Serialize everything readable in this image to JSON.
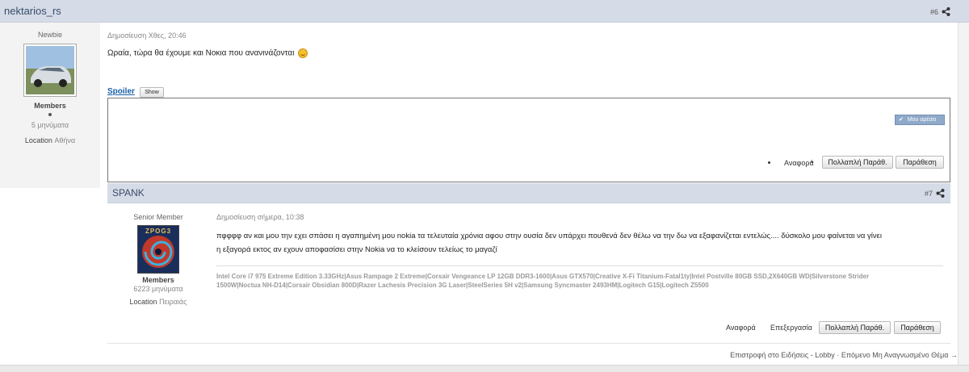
{
  "post1": {
    "author": "nektarios_rs",
    "number": "#6",
    "rank": "Newbie",
    "group": "Members",
    "posts": "5 μηνύματα",
    "location_label": "Location",
    "location": "Αθήνα",
    "date": "Δημοσίευση Χθες, 20:46",
    "text": "Ωραία, τώρα θα έχουμε και Νοκια που ανανινάζονται",
    "spoiler_label": "Spoiler",
    "spoiler_button": "Show",
    "like_button": "Μου αρέσει",
    "report": "Αναφορά",
    "multiquote": "Πολλαπλή Παράθ.",
    "quote": "Παράθεση"
  },
  "post2": {
    "author": "SPANK",
    "number": "#7",
    "rank": "Senior Member",
    "group": "Members",
    "posts": "6223 μηνύματα",
    "location_label": "Location",
    "location": "Πειραιάς",
    "date": "Δημοσίευση σήμερα, 10:38",
    "text_line1": "πφφφφ αν και μου την εχει σπάσει η αγαπημένη μου nokia τα τελευταία χρόνια αφου στην ουσία δεν υπάρχει πουθενά δεν θέλω να την δω να εξαφανίζεται εντελώς.... δύσκολο μου φαίνεται να γίνει",
    "text_line2": "η εξαγορά εκτος αν εχουν αποφασίσει στην Nokia να το κλείσουν τελείως το μαγαζί",
    "signature_line1": "Intel Core i7 975 Extreme Edition 3.33GHz|Asus Rampage 2 Extreme|Corsair Vengeance LP 12GB DDR3-1600|Asus GTX570|Creative X-Fi Titanium-Fatal1ty|Intel Postville 80GB SSD,2X640GB WD|Silverstone Strider",
    "signature_line2": "1500W|Noctua NH-D14|Corsair Obsidian 800D|Razer Lachesis Precision 3G Laser|SteelSeries 5H v2|Samsung Syncmaster 2493HM|Logitech G15|Logitech Z5500",
    "avatar_text": "ZPOG3",
    "report": "Αναφορά",
    "edit": "Επεξεργασία",
    "multiquote": "Πολλαπλή Παράθ.",
    "quote": "Παράθεση"
  },
  "footer": {
    "link1": "Επιστροφή στο Ειδήσεις - Lobby",
    "separator": "·",
    "link2": "Επόμενο Μη Αναγνωσμένο Θέμα",
    "arrow": "→"
  },
  "colors": {
    "header_bg": "#d5dbe7",
    "left_col_bg": "#f3f3f3",
    "link": "#1a5fa8"
  }
}
